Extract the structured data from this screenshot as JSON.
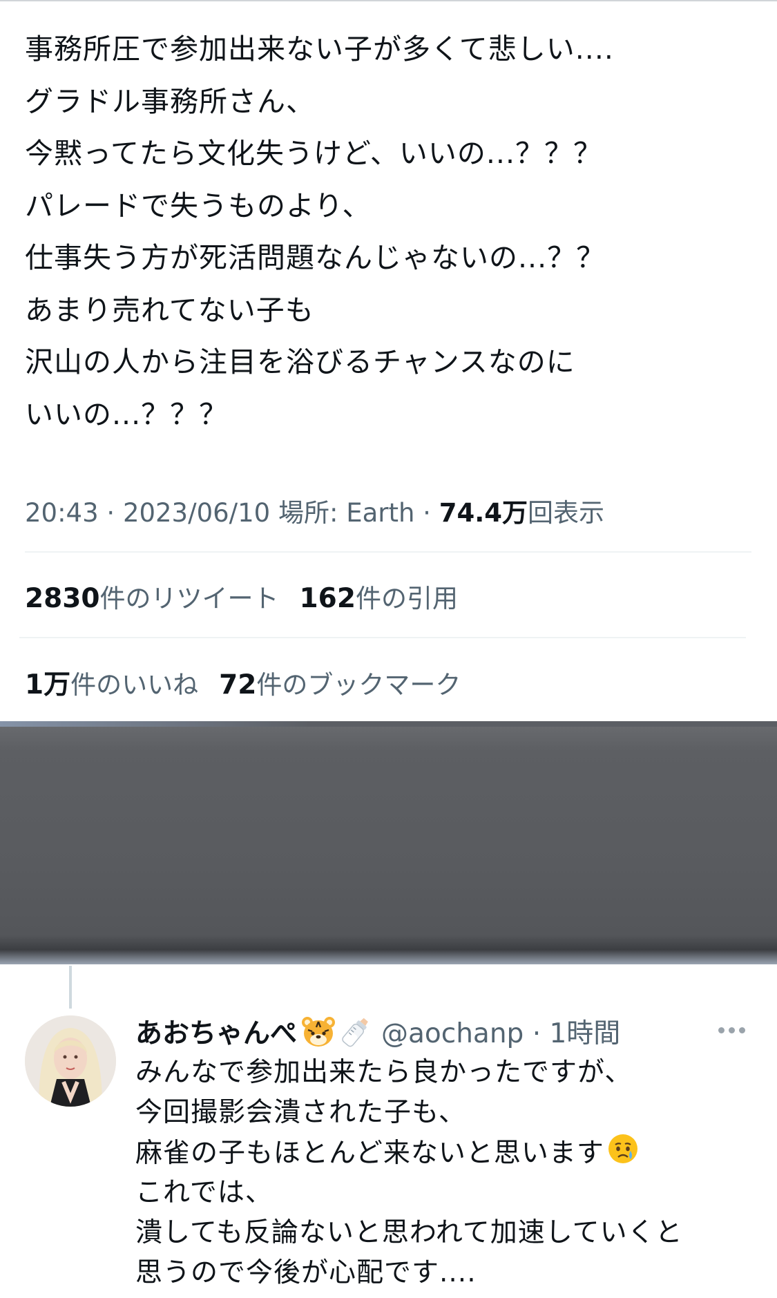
{
  "tweet": {
    "lines": [
      "事務所圧で参加出来ない子が多くて悲しい....",
      "グラドル事務所さん、",
      "今黙ってたら文化失うけど、いいの...？？？",
      "パレードで失うものより、",
      "仕事失う方が死活問題なんじゃないの...？？",
      "あまり売れてない子も",
      "沢山の人から注目を浴びるチャンスなのに",
      "いいの...？？？"
    ],
    "time": "20:43",
    "date": "2023/06/10",
    "location_label": "場所: Earth",
    "views_value": "74.4万",
    "views_label": "回表示",
    "separator": " · "
  },
  "stats": {
    "retweets_value": "2830",
    "retweets_label": "件のリツイート",
    "quotes_value": "162",
    "quotes_label": "件の引用",
    "likes_value": "1万",
    "likes_label": "件のいいね",
    "bookmarks_value": "72",
    "bookmarks_label": "件のブックマーク"
  },
  "reply": {
    "name": "あおちゃんぺ",
    "handle_time": "@aochanp · 1時間",
    "name_emojis": [
      "tiger-face-icon",
      "baby-bottle-icon"
    ],
    "lines": [
      "みんなで参加出来たら良かったですが、",
      "今回撮影会潰された子も、",
      "麻雀の子もほとんど来ないと思います",
      "これでは、",
      "潰しても反論ないと思われて加速していくと",
      "思うので今後が心配です...."
    ],
    "line3_emoji": "crying-face-icon"
  },
  "colors": {
    "text": "#0f1419",
    "secondary": "#536471",
    "divider": "#eff3f4",
    "media": "#595b5f"
  }
}
